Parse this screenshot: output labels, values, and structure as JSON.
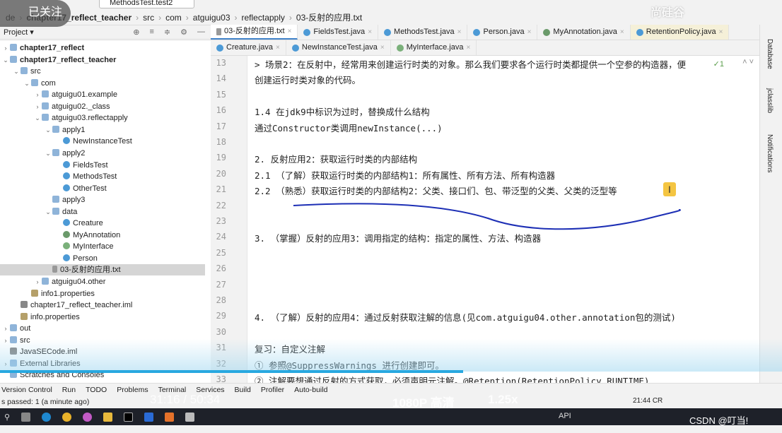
{
  "toolbar": {
    "run_config": "MethodsTest.test2",
    "follow_label": "已关注",
    "watermark": "尚硅谷"
  },
  "breadcrumb": [
    "de",
    "chapter17_reflect_teacher",
    "src",
    "com",
    "atguigu03",
    "reflectapply",
    "03-反射的应用.txt"
  ],
  "project": {
    "title": "Project",
    "icons": [
      "locate-icon",
      "expand-icon",
      "collapse-icon",
      "gear-icon",
      "minimize-icon"
    ]
  },
  "tree": [
    {
      "label": "chapter17_reflect",
      "indent": 0,
      "arrow": ">",
      "icon": "folder",
      "bold": true
    },
    {
      "label": "chapter17_reflect_teacher",
      "indent": 0,
      "arrow": "v",
      "icon": "folder",
      "bold": true
    },
    {
      "label": "src",
      "indent": 1,
      "arrow": "v",
      "icon": "folder"
    },
    {
      "label": "com",
      "indent": 2,
      "arrow": "v",
      "icon": "folder"
    },
    {
      "label": "atguigu01.example",
      "indent": 3,
      "arrow": ">",
      "icon": "folder"
    },
    {
      "label": "atguigu02._class",
      "indent": 3,
      "arrow": ">",
      "icon": "folder"
    },
    {
      "label": "atguigu03.reflectapply",
      "indent": 3,
      "arrow": "v",
      "icon": "folder"
    },
    {
      "label": "apply1",
      "indent": 4,
      "arrow": "v",
      "icon": "folder"
    },
    {
      "label": "NewInstanceTest",
      "indent": 5,
      "arrow": "",
      "icon": "cls"
    },
    {
      "label": "apply2",
      "indent": 4,
      "arrow": "v",
      "icon": "folder"
    },
    {
      "label": "FieldsTest",
      "indent": 5,
      "arrow": "",
      "icon": "cls"
    },
    {
      "label": "MethodsTest",
      "indent": 5,
      "arrow": "",
      "icon": "cls"
    },
    {
      "label": "OtherTest",
      "indent": 5,
      "arrow": "",
      "icon": "cls"
    },
    {
      "label": "apply3",
      "indent": 4,
      "arrow": "",
      "icon": "folder"
    },
    {
      "label": "data",
      "indent": 4,
      "arrow": "v",
      "icon": "folder"
    },
    {
      "label": "Creature",
      "indent": 5,
      "arrow": "",
      "icon": "cls"
    },
    {
      "label": "MyAnnotation",
      "indent": 5,
      "arrow": "",
      "icon": "ann"
    },
    {
      "label": "MyInterface",
      "indent": 5,
      "arrow": "",
      "icon": "intf"
    },
    {
      "label": "Person",
      "indent": 5,
      "arrow": "",
      "icon": "cls"
    },
    {
      "label": "03-反射的应用.txt",
      "indent": 4,
      "arrow": "",
      "icon": "txt",
      "selected": true
    },
    {
      "label": "atguigu04.other",
      "indent": 3,
      "arrow": ">",
      "icon": "folder"
    },
    {
      "label": "info1.properties",
      "indent": 2,
      "arrow": "",
      "icon": "props"
    },
    {
      "label": "chapter17_reflect_teacher.iml",
      "indent": 1,
      "arrow": "",
      "icon": "mod"
    },
    {
      "label": "info.properties",
      "indent": 1,
      "arrow": "",
      "icon": "props"
    },
    {
      "label": "out",
      "indent": 0,
      "arrow": ">",
      "icon": "folder"
    },
    {
      "label": "src",
      "indent": 0,
      "arrow": ">",
      "icon": "folder"
    },
    {
      "label": "JavaSECode.iml",
      "indent": 0,
      "arrow": "",
      "icon": "mod"
    },
    {
      "label": "External Libraries",
      "indent": 0,
      "arrow": ">",
      "icon": "folder"
    },
    {
      "label": "Scratches and Consoles",
      "indent": 0,
      "arrow": "",
      "icon": "folder"
    }
  ],
  "tabs_row1": [
    {
      "label": "03-反射的应用.txt",
      "icon": "text-file",
      "color": "#999999",
      "active": true
    },
    {
      "label": "FieldsTest.java",
      "icon": "class",
      "color": "#4c9ad6"
    },
    {
      "label": "MethodsTest.java",
      "icon": "class",
      "color": "#4c9ad6"
    },
    {
      "label": "Person.java",
      "icon": "class",
      "color": "#4c9ad6"
    },
    {
      "label": "MyAnnotation.java",
      "icon": "annotation",
      "color": "#6a9a6a"
    },
    {
      "label": "RetentionPolicy.java",
      "icon": "enum",
      "color": "#4c9ad6",
      "highlight": true
    }
  ],
  "tabs_row2": [
    {
      "label": "Creature.java",
      "icon": "class",
      "color": "#4c9ad6"
    },
    {
      "label": "NewInstanceTest.java",
      "icon": "class",
      "color": "#4c9ad6"
    },
    {
      "label": "MyInterface.java",
      "icon": "interface",
      "color": "#7ab07a"
    }
  ],
  "editor": {
    "inspection": "✓1",
    "lines": [
      {
        "n": "13",
        "t": "> 场景2：在反射中，经常用来创建运行时类的对象。那么我们要求各个运行时类都提供一个空参的构造器，便"
      },
      {
        "n": "14",
        "t": "        创建运行时类对象的代码。"
      },
      {
        "n": "15",
        "t": ""
      },
      {
        "n": "16",
        "t": "1.4 在jdk9中标识为过时，替换成什么结构"
      },
      {
        "n": "17",
        "t": "通过Constructor类调用newInstance(...)"
      },
      {
        "n": "18",
        "t": ""
      },
      {
        "n": "19",
        "t": "2. 反射应用2：获取运行时类的内部结构"
      },
      {
        "n": "20",
        "t": "2.1 （了解）获取运行时类的内部结构1：所有属性、所有方法、所有构造器"
      },
      {
        "n": "21",
        "t": "2.2 （熟悉）获取运行时类的内部结构2：父类、接口们、包、带泛型的父类、父类的泛型等"
      },
      {
        "n": "22",
        "t": ""
      },
      {
        "n": "23",
        "t": ""
      },
      {
        "n": "24",
        "t": "3. （掌握）反射的应用3：调用指定的结构：指定的属性、方法、构造器"
      },
      {
        "n": "25",
        "t": ""
      },
      {
        "n": "26",
        "t": ""
      },
      {
        "n": "27",
        "t": ""
      },
      {
        "n": "28",
        "t": ""
      },
      {
        "n": "29",
        "t": "4. （了解）反射的应用4：通过反射获取注解的信息(见com.atguigu04.other.annotation包的测试)"
      },
      {
        "n": "30",
        "t": ""
      },
      {
        "n": "31",
        "t": "复习：自定义注解"
      },
      {
        "n": "32",
        "t": "① 参照@SuppressWarnings 进行创建即可。"
      },
      {
        "n": "33",
        "t": "② 注解要想通过反射的方式获取，必须声明元注解。@Retention(RetentionPolicy.RUNTIME)"
      }
    ]
  },
  "right_tools": [
    "Database",
    "jclasslib",
    "Notifications"
  ],
  "bottom_tools": [
    "Version Control",
    "Run",
    "TODO",
    "Problems",
    "Terminal",
    "Services",
    "Build",
    "Profiler",
    "Auto-build"
  ],
  "status": {
    "text": "s passed: 1 (a minute ago)",
    "clock": "21:44",
    "encoding": "CR"
  },
  "video": {
    "time": "31:16 / 50:34",
    "quality": "1080P 高清",
    "speed": "1.25x",
    "progress_percent": 61.8
  },
  "taskbar": {
    "right": "API",
    "credit": "CSDN @叮当!"
  }
}
